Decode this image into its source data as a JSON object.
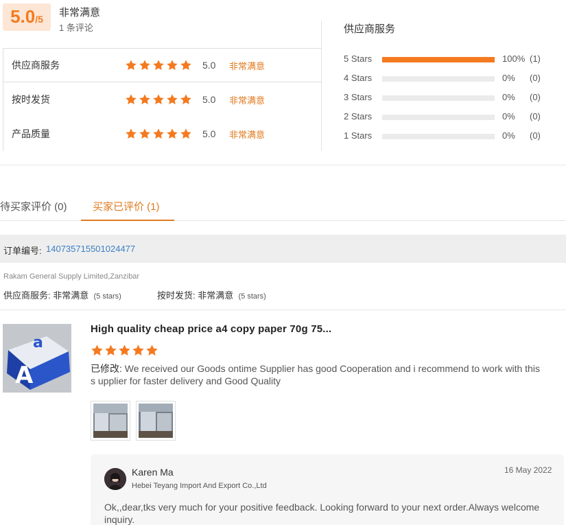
{
  "summary": {
    "score": "5.0",
    "score_max": "/5",
    "title": "非常满意",
    "count": "1 条评论"
  },
  "ratings": [
    {
      "label": "供应商服务",
      "stars": 5,
      "value": "5.0",
      "desc": "非常满意"
    },
    {
      "label": "按时发货",
      "stars": 5,
      "value": "5.0",
      "desc": "非常满意"
    },
    {
      "label": "产品质量",
      "stars": 5,
      "value": "5.0",
      "desc": "非常满意"
    }
  ],
  "distribution": {
    "title": "供应商服务",
    "rows": [
      {
        "label": "5  Stars",
        "percent": 100,
        "percent_text": "100%",
        "count": "(1)"
      },
      {
        "label": "4  Stars",
        "percent": 0,
        "percent_text": "0%",
        "count": "(0)"
      },
      {
        "label": "3  Stars",
        "percent": 0,
        "percent_text": "0%",
        "count": "(0)"
      },
      {
        "label": "2  Stars",
        "percent": 0,
        "percent_text": "0%",
        "count": "(0)"
      },
      {
        "label": "1  Stars",
        "percent": 0,
        "percent_text": "0%",
        "count": "(0)"
      }
    ]
  },
  "tabs": [
    {
      "label": "待买家评价 (0)",
      "active": false
    },
    {
      "label": "买家已评价 (1)",
      "active": true
    }
  ],
  "order": {
    "label": "订单编号:",
    "number": "140735715501024477"
  },
  "buyer": {
    "name": "Rakam General Supply Limited,Zanzibar",
    "service_label": "供应商服务:",
    "service_value": "非常满意",
    "service_stars": "(5 stars)",
    "shipping_label": "按时发货:",
    "shipping_value": "非常满意",
    "shipping_stars": "(5 stars)"
  },
  "review": {
    "product_title": "High quality cheap price a4 copy paper 70g 75...",
    "stars": 5,
    "edited_prefix": "已修改:",
    "text": "We received our Goods ontime Supplier has good Cooperation and i recommend to work with this s upplier for faster delivery and Good Quality"
  },
  "reply": {
    "name": "Karen Ma",
    "company": "Hebei Teyang Import And Export Co.,Ltd",
    "date": "16 May 2022",
    "text": "Ok,,dear,tks very much for your positive feedback. Looking forward to your next order.Always welcome inquiry."
  },
  "colors": {
    "accent": "#f47a20",
    "accent_text": "#e07b20",
    "link": "#3b7fc4"
  },
  "icons": {
    "star": "star-icon"
  }
}
